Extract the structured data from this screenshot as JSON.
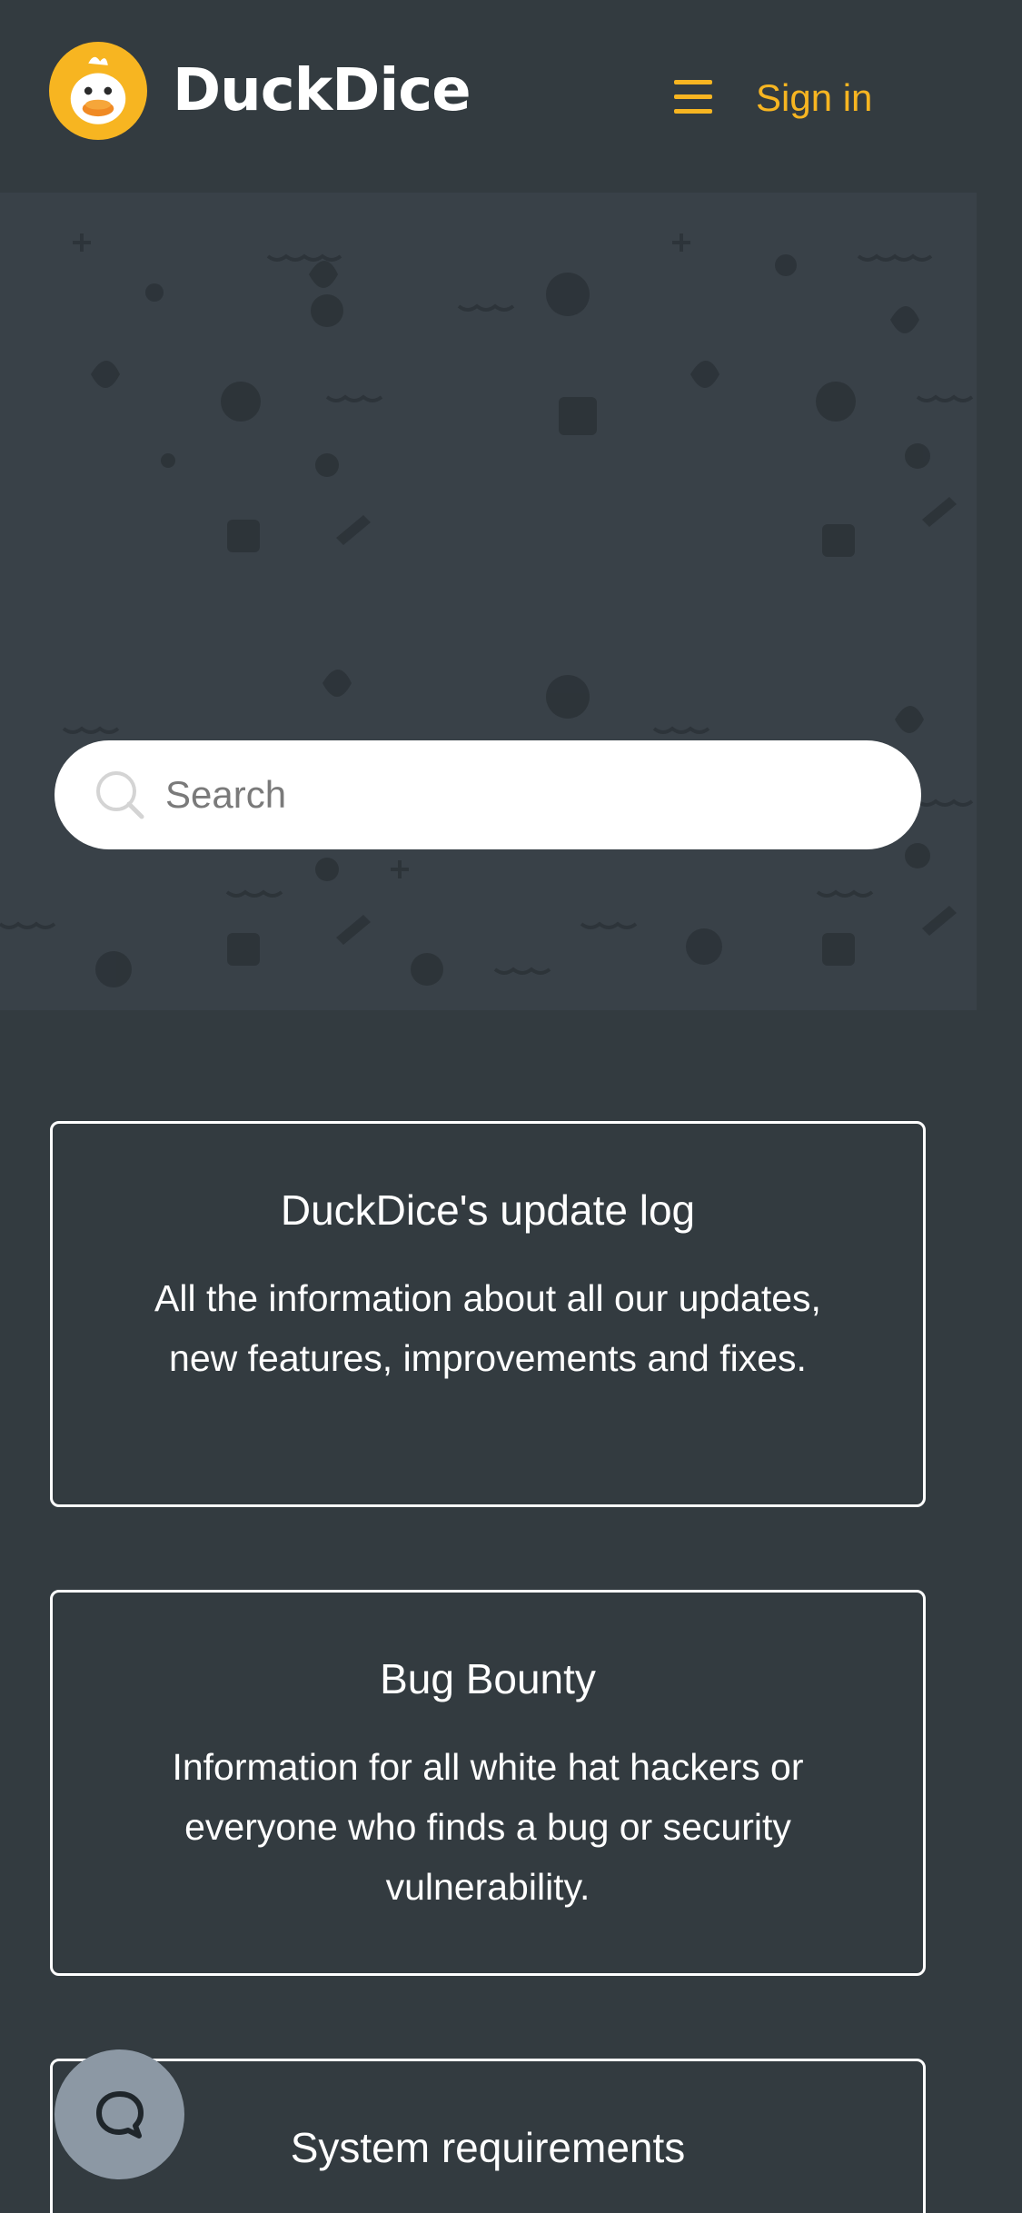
{
  "header": {
    "brand": "DuckDice",
    "signin_label": "Sign in"
  },
  "hero": {
    "search_placeholder": "Search"
  },
  "cards": [
    {
      "title": "DuckDice's update log",
      "description": "All the information about all our updates, new features, improvements and fixes."
    },
    {
      "title": "Bug Bounty",
      "description": "Information for all white hat hackers or everyone who finds a bug or security vulnerability."
    },
    {
      "title": "System requirements",
      "description": ""
    }
  ],
  "colors": {
    "background": "#333b40",
    "hero_background": "#394148",
    "accent": "#f7b521",
    "chat_button": "#8c98a4"
  },
  "icons": {
    "logo": "duck-logo-icon",
    "menu": "hamburger-menu-icon",
    "search": "search-icon",
    "chat": "chat-bubble-icon"
  }
}
